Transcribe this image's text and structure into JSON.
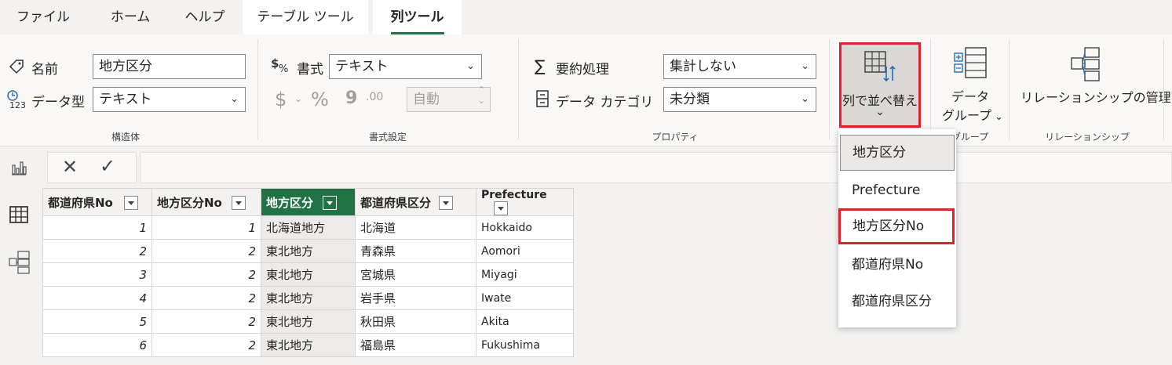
{
  "tabs": [
    "ファイル",
    "ホーム",
    "ヘルプ",
    "テーブル ツール",
    "列ツール"
  ],
  "ribbon": {
    "structure": {
      "name_label": "名前",
      "name_value": "地方区分",
      "datatype_label": "データ型",
      "datatype_value": "テキスト",
      "group_label": "構造体"
    },
    "format": {
      "format_label": "書式",
      "format_value": "テキスト",
      "currency_symbol": "$",
      "percent_symbol": "%",
      "comma_symbol": "9",
      "decimal_symbol": ".00",
      "auto_value": "自動",
      "group_label": "書式設定"
    },
    "properties": {
      "summarize_label": "要約処理",
      "summarize_value": "集計しない",
      "category_label": "データ カテゴリ",
      "category_value": "未分類",
      "group_label": "プロパティ"
    },
    "sort": {
      "label": "列で並べ替え",
      "chevron": "⌄"
    },
    "data_group": {
      "label_line1": "データ",
      "label_line2": "グループ",
      "group_label_partial": "グループ"
    },
    "relationships": {
      "label": "リレーションシップの管理",
      "group_label": "リレーションシップ"
    }
  },
  "formula": {
    "cancel": "✕",
    "commit": "✓"
  },
  "table": {
    "columns": [
      "都道府県No",
      "地方区分No",
      "地方区分",
      "都道府県区分",
      "Prefecture"
    ],
    "rows": [
      [
        "1",
        "1",
        "北海道地方",
        "北海道",
        "Hokkaido"
      ],
      [
        "2",
        "2",
        "東北地方",
        "青森県",
        "Aomori"
      ],
      [
        "3",
        "2",
        "東北地方",
        "宮城県",
        "Miyagi"
      ],
      [
        "4",
        "2",
        "東北地方",
        "岩手県",
        "Iwate"
      ],
      [
        "5",
        "2",
        "東北地方",
        "秋田県",
        "Akita"
      ],
      [
        "6",
        "2",
        "東北地方",
        "福島県",
        "Fukushima"
      ]
    ]
  },
  "sort_menu": {
    "items": [
      "地方区分",
      "Prefecture",
      "地方区分No",
      "都道府県No",
      "都道府県区分"
    ]
  },
  "colors": {
    "accent": "#217346",
    "highlight_border": "#e0202a"
  }
}
